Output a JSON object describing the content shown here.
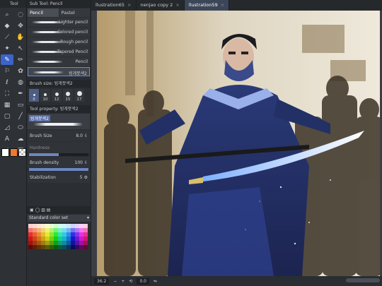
{
  "tool_panel": {
    "title": "Tool"
  },
  "subtool": {
    "title": "Sub Tool: Pencil",
    "tabs": [
      "Pencil",
      "Pastel"
    ],
    "brushes": [
      "Lighter pencil",
      "Colored pencil",
      "Rough pencil",
      "Tapered Pencil",
      "Pencil",
      "빙개붓색2"
    ]
  },
  "brush_size": {
    "title": "Brush size: 빙개붓색2",
    "sizes": [
      "8",
      "10",
      "12",
      "15",
      "17"
    ],
    "selected": "8"
  },
  "tool_property": {
    "title": "Tool property: 빙개붓색2",
    "preset": "빙개붓색2",
    "brush_size": {
      "label": "Brush Size",
      "value": "8.0"
    },
    "hardness": {
      "label": "Hardness",
      "fraction": 0.5
    },
    "brush_density": {
      "label": "Brush density",
      "value": "100",
      "fraction": 1.0
    },
    "stabilization": {
      "label": "Stabilization",
      "value": "5"
    }
  },
  "color_set": {
    "title": "Standard color set"
  },
  "documents": {
    "tabs": [
      "llustration65",
      "nenjao copy 2",
      "llustration59"
    ],
    "selected": 2
  },
  "status": {
    "zoom": "36.2",
    "angle": "0.0"
  },
  "colors": {
    "main": "#ffffff",
    "sub": "#ef7a2e",
    "accent": "#3c64c8"
  }
}
